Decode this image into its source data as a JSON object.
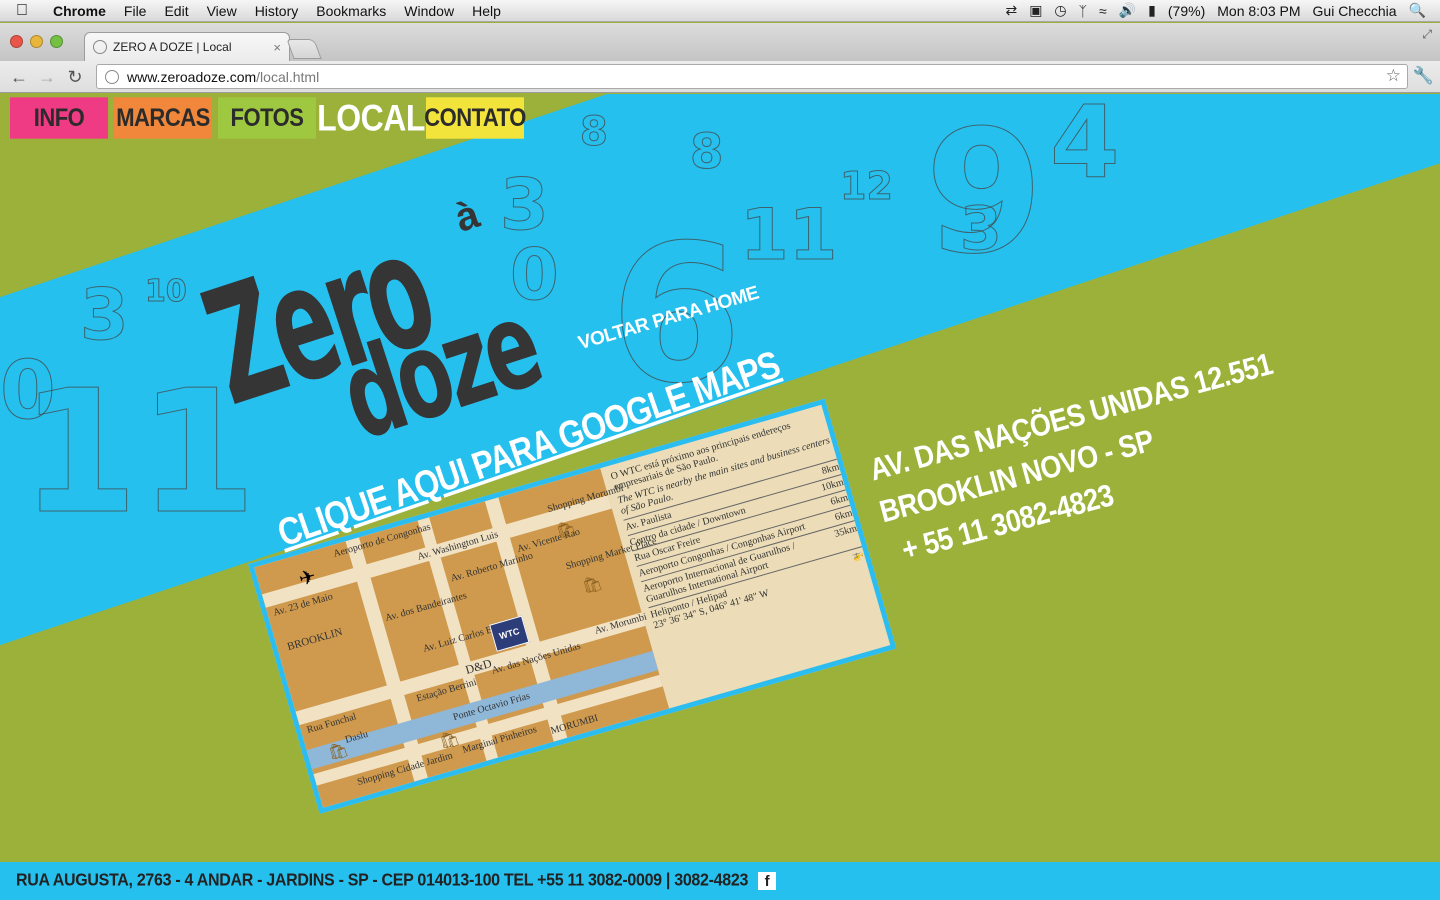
{
  "menubar": {
    "apple_icon": "apple-icon",
    "app_name": "Chrome",
    "items": [
      "File",
      "Edit",
      "View",
      "History",
      "Bookmarks",
      "Window",
      "Help"
    ],
    "battery": "(79%)",
    "clock": "Mon 8:03 PM",
    "user": "Gui Checchia"
  },
  "browser": {
    "tab_title": "ZERO A DOZE | Local",
    "url_host": "www.zeroadoze.com",
    "url_path": "/local.html"
  },
  "nav": {
    "info": "INFO",
    "marcas": "MARCAS",
    "fotos": "FOTOS",
    "local": "LOCAL",
    "contato": "CONTATO"
  },
  "logo": {
    "zero": "Zero",
    "a": "à",
    "doze": "doze"
  },
  "voltar": "VOLTAR PARA HOME",
  "maps_link": "CLIQUE AQUI PARA GOOGLE MAPS",
  "address": {
    "line1": "AV. DAS NAÇÕES UNIDAS 12.551",
    "line2": "BROOKLIN NOVO - SP",
    "phone": "+ 55 11 3082-4823"
  },
  "map": {
    "intro_pt": "O WTC está próximo aos principais endereços empresariais de São Paulo.",
    "intro_en": "The WTC is nearby the main sites and business centers of São Paulo.",
    "distances": [
      {
        "place": "Av. Paulista",
        "km": "8km"
      },
      {
        "place": "Centro da cidade / Downtown",
        "km": "10km"
      },
      {
        "place": "Rua Oscar Freire",
        "km": "6km"
      },
      {
        "place": "Aeroporto Congonhas / Congonhas Airport",
        "km": "6km"
      },
      {
        "place": "Aeroporto Internacional de Guarulhos / Guarulhos International Airport",
        "km": "35km"
      },
      {
        "place": "Heliponto / Helipad",
        "km": ""
      }
    ],
    "coords": "23° 36' 34\" S, 046° 41' 48\" W",
    "labels": {
      "aeroporto": "Aeroporto de Congonhas",
      "washington": "Av. Washington Luis",
      "maio": "Av. 23 de Maio",
      "brooklin": "BROOKLIN",
      "bandeirantes": "Av. dos Bandeirantes",
      "berrini": "Av. Luiz Carlos Berrini",
      "marinho": "Av. Roberto Marinho",
      "vicente": "Av. Vicente Rao",
      "morumbi_shop": "Shopping Morumbi",
      "market": "Shopping Market Place",
      "funchal": "Rua Funchal",
      "estacao": "Estação Berrini",
      "dd": "D&D",
      "nacoes": "Av. das Nações Unidas",
      "frias": "Ponte Octavio Frias",
      "pinheiros": "Marginal Pinheiros",
      "morumbi": "MORUMBI",
      "av_morumbi": "Av. Morumbi",
      "daslu": "Daslu",
      "cidade_jardim": "Shopping Cidade Jardim",
      "wtc": "WTC"
    }
  },
  "footer": {
    "text": "RUA AUGUSTA, 2763 - 4 ANDAR - JARDINS - SP - CEP 014013-100 TEL +55 11  3082-0009 | 3082-4823",
    "facebook": "f"
  }
}
